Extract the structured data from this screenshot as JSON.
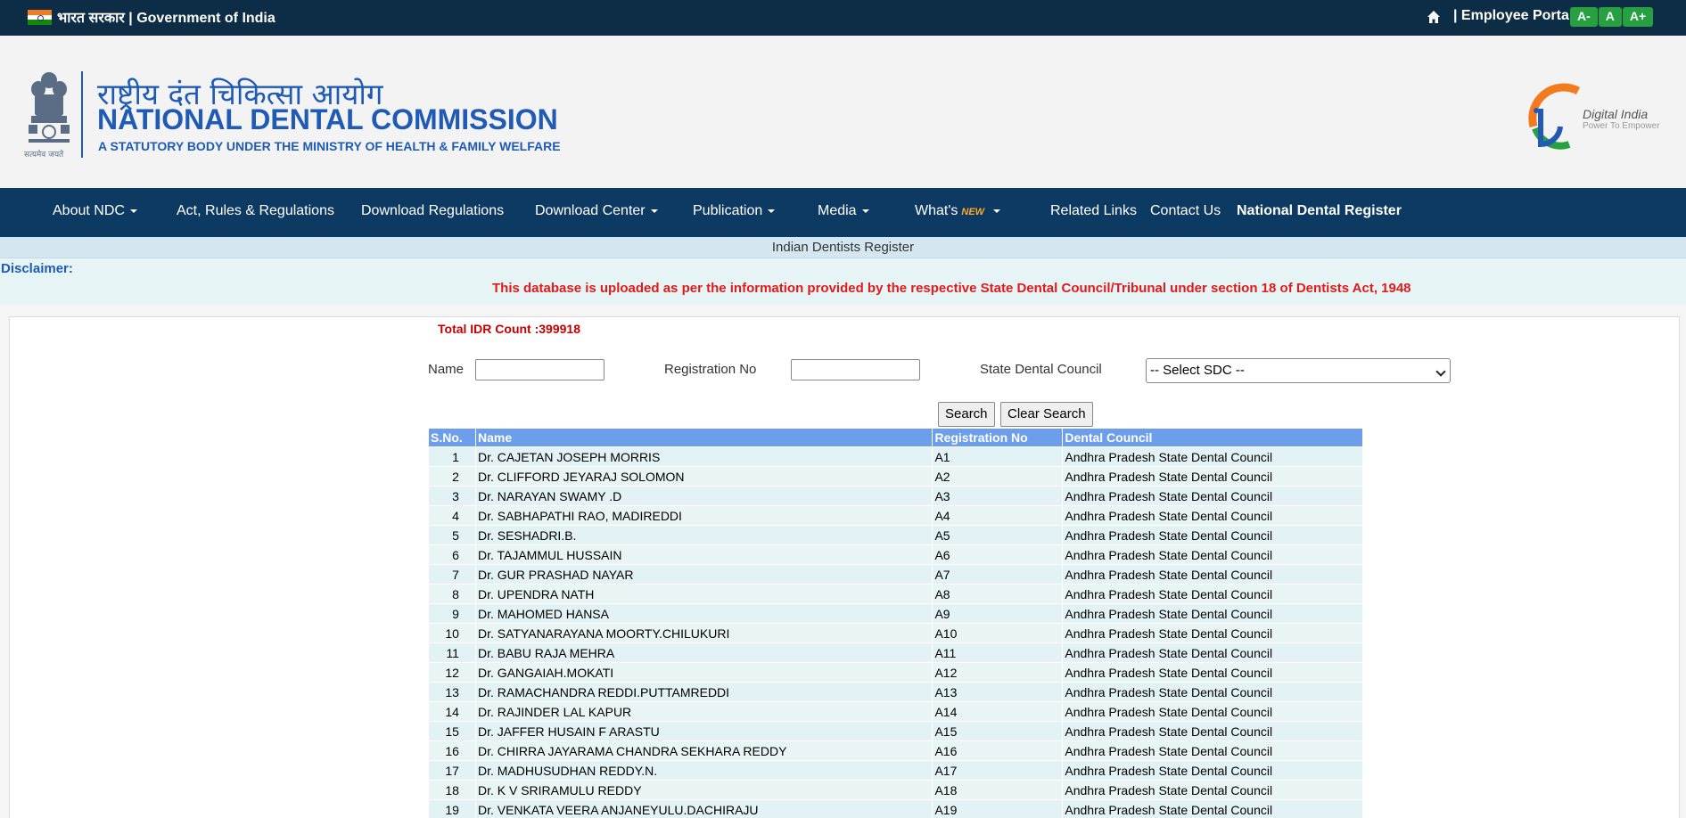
{
  "topbar": {
    "gov_text": "भारत सरकार | Government of India",
    "employee_portal": "| Employee Portal",
    "font_buttons": [
      "A-",
      "A",
      "A+"
    ]
  },
  "header": {
    "hindi_title": "राष्ट्रीय दंत चिकित्सा आयोग",
    "title": "NATIONAL DENTAL COMMISSION",
    "subtitle": "A STATUTORY BODY UNDER THE MINISTRY OF HEALTH & FAMILY WELFARE",
    "emblem_caption": "सत्यमेव जयते",
    "digital_india": "Digital India",
    "digital_india_tagline": "Power To Empower"
  },
  "nav": {
    "items": [
      {
        "label": "About NDC"
      },
      {
        "label": "Act, Rules & Regulations"
      },
      {
        "label": "Download Regulations"
      },
      {
        "label": "Download Center"
      },
      {
        "label": "Publication"
      },
      {
        "label": "Media"
      },
      {
        "label": "What's"
      },
      {
        "label": "Related Links"
      },
      {
        "label": "Contact Us"
      },
      {
        "label": "National Dental Register"
      }
    ],
    "new_badge": "NEW"
  },
  "section": {
    "title": "Indian Dentists Register",
    "disclaimer_label": "Disclaimer:",
    "disclaimer_text": "This database is uploaded as per the information provided by the respective State Dental Council/Tribunal under section 18 of Dentists Act, 1948"
  },
  "search": {
    "total_count": "Total IDR Count :399918",
    "name_label": "Name",
    "name_value": "",
    "reg_label": "Registration No",
    "reg_value": "",
    "sdc_label": "State Dental Council",
    "sdc_selected": "-- Select SDC --",
    "search_button": "Search",
    "clear_button": "Clear Search"
  },
  "table": {
    "headers": [
      "S.No.",
      "Name",
      "Registration No",
      "Dental Council"
    ],
    "rows": [
      [
        "1",
        "Dr. CAJETAN JOSEPH MORRIS",
        "A1",
        "Andhra Pradesh State Dental Council"
      ],
      [
        "2",
        "Dr. CLIFFORD JEYARAJ SOLOMON",
        "A2",
        "Andhra Pradesh State Dental Council"
      ],
      [
        "3",
        "Dr. NARAYAN SWAMY .D",
        "A3",
        "Andhra Pradesh State Dental Council"
      ],
      [
        "4",
        "Dr. SABHAPATHI RAO, MADIREDDI",
        "A4",
        "Andhra Pradesh State Dental Council"
      ],
      [
        "5",
        "Dr. SESHADRI.B.",
        "A5",
        "Andhra Pradesh State Dental Council"
      ],
      [
        "6",
        "Dr. TAJAMMUL HUSSAIN",
        "A6",
        "Andhra Pradesh State Dental Council"
      ],
      [
        "7",
        "Dr. GUR PRASHAD NAYAR",
        "A7",
        "Andhra Pradesh State Dental Council"
      ],
      [
        "8",
        "Dr. UPENDRA NATH",
        "A8",
        "Andhra Pradesh State Dental Council"
      ],
      [
        "9",
        "Dr. MAHOMED HANSA",
        "A9",
        "Andhra Pradesh State Dental Council"
      ],
      [
        "10",
        "Dr. SATYANARAYANA MOORTY.CHILUKURI",
        "A10",
        "Andhra Pradesh State Dental Council"
      ],
      [
        "11",
        "Dr. BABU RAJA MEHRA",
        "A11",
        "Andhra Pradesh State Dental Council"
      ],
      [
        "12",
        "Dr. GANGAIAH.MOKATI",
        "A12",
        "Andhra Pradesh State Dental Council"
      ],
      [
        "13",
        "Dr. RAMACHANDRA REDDI.PUTTAMREDDI",
        "A13",
        "Andhra Pradesh State Dental Council"
      ],
      [
        "14",
        "Dr. RAJINDER LAL KAPUR",
        "A14",
        "Andhra Pradesh State Dental Council"
      ],
      [
        "15",
        "Dr. JAFFER HUSAIN F ARASTU",
        "A15",
        "Andhra Pradesh State Dental Council"
      ],
      [
        "16",
        "Dr. CHIRRA JAYARAMA CHANDRA SEKHARA REDDY",
        "A16",
        "Andhra Pradesh State Dental Council"
      ],
      [
        "17",
        "Dr. MADHUSUDHAN REDDY.N.",
        "A17",
        "Andhra Pradesh State Dental Council"
      ],
      [
        "18",
        "Dr. K V SRIRAMULU REDDY",
        "A18",
        "Andhra Pradesh State Dental Council"
      ],
      [
        "19",
        "Dr. VENKATA VEERA ANJANEYULU.DACHIRAJU",
        "A19",
        "Andhra Pradesh State Dental Council"
      ]
    ]
  }
}
